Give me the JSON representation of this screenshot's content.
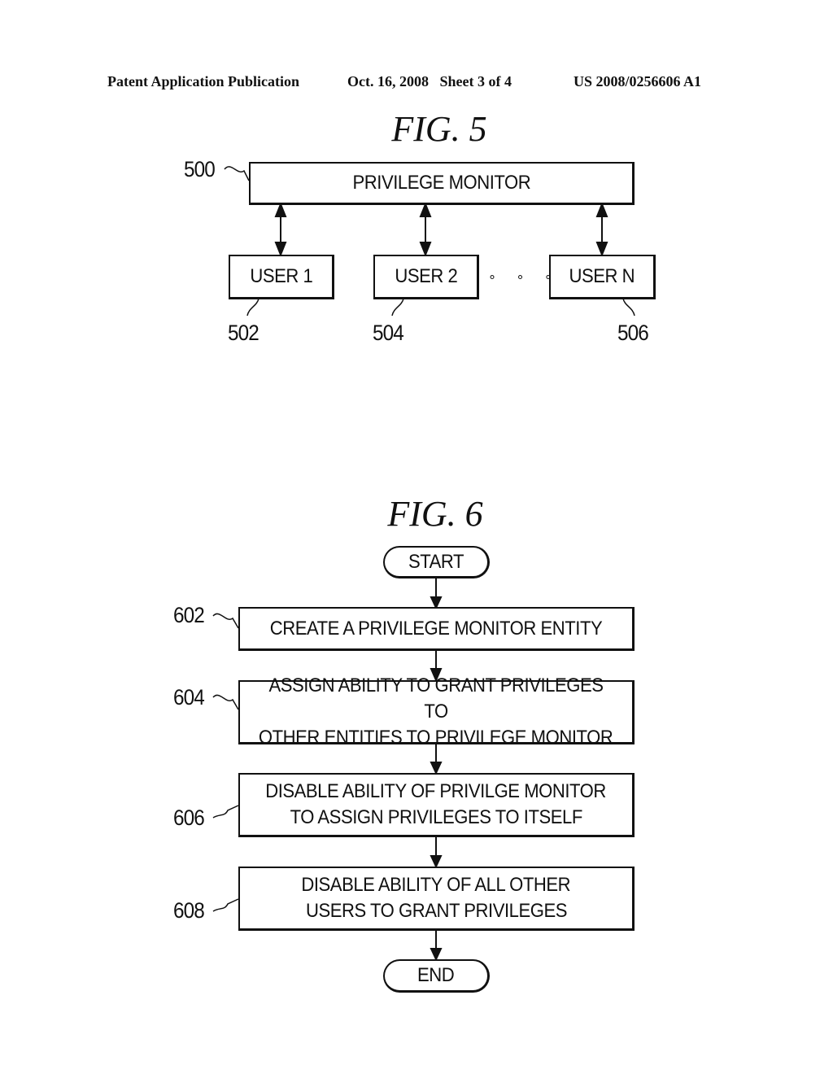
{
  "header": {
    "publication": "Patent Application Publication",
    "date_sheet": "Oct. 16, 2008   Sheet 3 of 4",
    "number": "US 2008/0256606 A1"
  },
  "fig5": {
    "title": "FIG. 5",
    "monitor": {
      "label": "PRIVILEGE MONITOR",
      "ref": "500"
    },
    "users": [
      {
        "label": "USER 1",
        "ref": "502"
      },
      {
        "label": "USER 2",
        "ref": "504"
      },
      {
        "label": "USER N",
        "ref": "506"
      }
    ],
    "ellipsis": "∘ ∘ ∘"
  },
  "fig6": {
    "title": "FIG. 6",
    "start": "START",
    "end": "END",
    "steps": [
      {
        "ref": "602",
        "line1": "CREATE A PRIVILEGE MONITOR ENTITY",
        "line2": ""
      },
      {
        "ref": "604",
        "line1": "ASSIGN ABILITY TO GRANT PRIVILEGES TO",
        "line2": "OTHER ENTITIES TO PRIVILEGE MONITOR"
      },
      {
        "ref": "606",
        "line1": "DISABLE ABILITY OF PRIVILGE MONITOR",
        "line2": "TO ASSIGN PRIVILEGES TO ITSELF"
      },
      {
        "ref": "608",
        "line1": "DISABLE ABILITY OF ALL OTHER",
        "line2": "USERS TO GRANT PRIVILEGES"
      }
    ]
  }
}
